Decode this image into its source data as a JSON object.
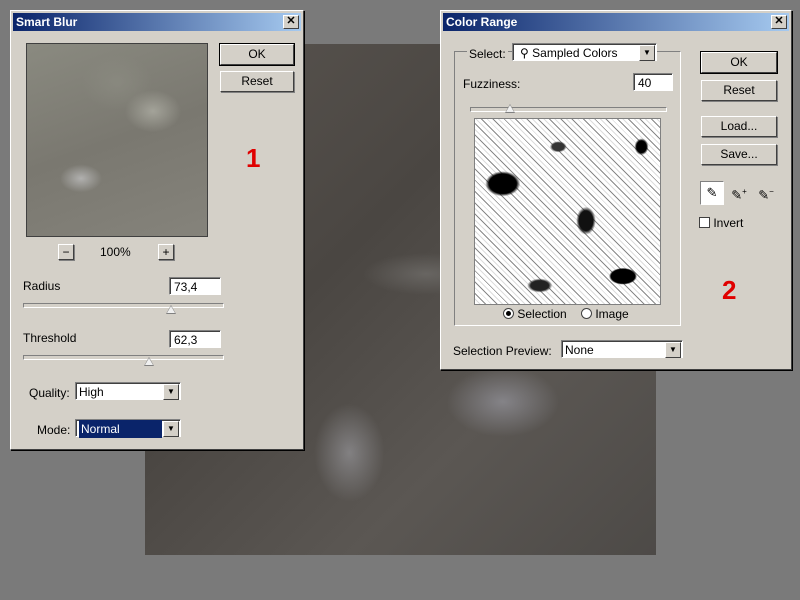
{
  "smart_blur": {
    "title": "Smart Blur",
    "ok": "OK",
    "reset": "Reset",
    "zoom": "100%",
    "zoom_out": "−",
    "zoom_in": "+",
    "radius_label": "Radius",
    "radius_value": "73,4",
    "radius_fraction": 0.73,
    "threshold_label": "Threshold",
    "threshold_value": "62,3",
    "threshold_fraction": 0.62,
    "quality_label": "Quality:",
    "quality_value": "High",
    "mode_label": "Mode:",
    "mode_value": "Normal",
    "marker": "1"
  },
  "color_range": {
    "title": "Color Range",
    "select_label": "Select:",
    "select_value": "Sampled Colors",
    "fuzziness_label": "Fuzziness:",
    "fuzziness_value": "40",
    "fuzziness_fraction": 0.2,
    "ok": "OK",
    "reset": "Reset",
    "load": "Load...",
    "save": "Save...",
    "invert_label": "Invert",
    "radio_selection": "Selection",
    "radio_image": "Image",
    "preview_label": "Selection Preview:",
    "preview_value": "None",
    "marker": "2"
  },
  "icons": [
    "close-icon",
    "eyedropper-icon",
    "eyedropper-plus-icon",
    "eyedropper-minus-icon"
  ],
  "colors": {
    "title_bar": "#0a246a",
    "marker": "#e00000",
    "dialog_bg": "#d4d0c8"
  }
}
